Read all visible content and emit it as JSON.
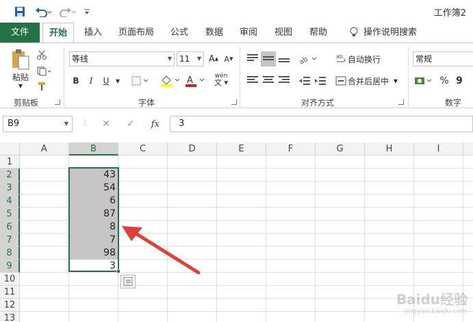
{
  "window": {
    "title": "工作簿2"
  },
  "qat": {
    "save_icon": "save-icon",
    "undo_icon": "undo-icon",
    "redo_icon": "redo-icon",
    "customize_icon": "customize-qat-icon"
  },
  "ribbon_tabs": [
    {
      "label": "文件"
    },
    {
      "label": "开始"
    },
    {
      "label": "插入"
    },
    {
      "label": "页面布局"
    },
    {
      "label": "公式"
    },
    {
      "label": "数据"
    },
    {
      "label": "审阅"
    },
    {
      "label": "视图"
    },
    {
      "label": "帮助"
    },
    {
      "label": "操作说明搜索"
    }
  ],
  "ribbon": {
    "clipboard": {
      "paste_label": "粘贴",
      "group_label": "剪贴板"
    },
    "font": {
      "font_name": "等线",
      "font_size": "11",
      "group_label": "字体",
      "bold": "B",
      "italic": "I",
      "underline": "U",
      "phonetic": "wén"
    },
    "alignment": {
      "wrap_text": "自动换行",
      "merge_center": "合并后居中",
      "group_label": "对齐方式"
    },
    "number": {
      "format": "常规",
      "percent": "%",
      "comma": "9",
      "group_label": "数字"
    }
  },
  "formula_bar": {
    "name_box": "B9",
    "fx_label": "fx",
    "formula": "3"
  },
  "sheet": {
    "columns": [
      "A",
      "B",
      "C",
      "D",
      "E",
      "F",
      "G",
      "H",
      "I"
    ],
    "selected_column": "B",
    "rows": [
      "1",
      "2",
      "3",
      "4",
      "5",
      "6",
      "7",
      "8",
      "9",
      "10",
      "11",
      "12",
      "13"
    ],
    "selected_range": "B2:B9",
    "column_b_values": [
      "",
      "43",
      "54",
      "6",
      "87",
      "8",
      "7",
      "98",
      "3"
    ]
  },
  "colors": {
    "excel_green": "#217346",
    "arrow_red": "#e0403a",
    "selection_fill": "#c6c6c6"
  },
  "watermark": {
    "brand": "Baidu经验",
    "url": "jingyan.baidu.com"
  }
}
